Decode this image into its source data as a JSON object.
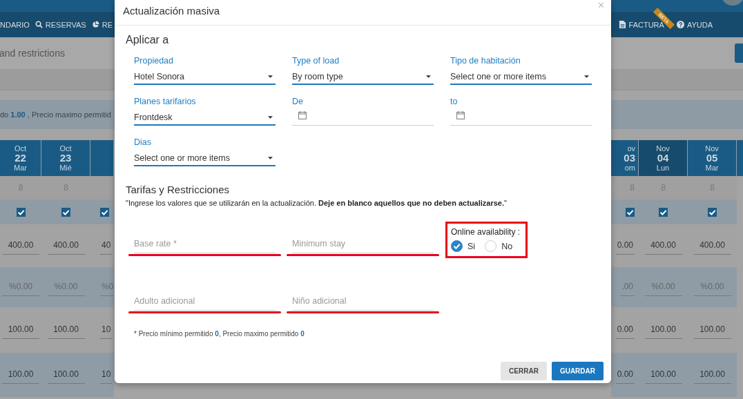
{
  "nav_left": [
    {
      "label": "NDARIO"
    },
    {
      "label": "RESERVAS"
    },
    {
      "label": "RE"
    }
  ],
  "nav_right": [
    {
      "label": "FACTURA",
      "badge": "BETA"
    },
    {
      "label": "AYUDA"
    }
  ],
  "page_title": "and restrictions",
  "notice": "do **1.00** , Precio maximo permitid",
  "calendar_left": [
    {
      "month": "Oct",
      "day": "22",
      "weekday": "Mar",
      "available": "8",
      "checked": true,
      "rate": "400.00",
      "percent": "%0.00",
      "adult": "100.00",
      "child": "100.00"
    },
    {
      "month": "Oct",
      "day": "23",
      "weekday": "Mié",
      "available": "8",
      "checked": true,
      "rate": "400.00",
      "percent": "%0.00",
      "adult": "100.00",
      "child": "100.00"
    },
    {
      "checked": true,
      "rate": "40",
      "percent": "%0",
      "adult": "10",
      "child": "10"
    }
  ],
  "calendar_right": [
    {
      "month": "ov",
      "day": "03",
      "weekday": "om",
      "available": "8",
      "checked": true,
      "rate": "0.00",
      "percent": ".00",
      "adult": "0.00",
      "child": "0.00"
    },
    {
      "month": "Nov",
      "day": "04",
      "weekday": "Lun",
      "available": "8",
      "checked": true,
      "rate": "400.00",
      "percent": "%0.00",
      "adult": "100.00",
      "child": "100.00"
    },
    {
      "month": "Nov",
      "day": "05",
      "weekday": "Mar",
      "available": "8",
      "checked": true,
      "rate": "400.00",
      "percent": "%0.00",
      "adult": "100.00",
      "child": "100.00"
    }
  ],
  "modal": {
    "title": "Actualización masiva",
    "close": "×",
    "apply_title": "Aplicar a",
    "fields": [
      {
        "kind": "select",
        "label": "Propiedad",
        "value": "Hotel Sonora"
      },
      {
        "kind": "select",
        "label": "Type of load",
        "value": "By room type"
      },
      {
        "kind": "select",
        "label": "Tipo de habitación",
        "placeholder": "Select one or more items"
      },
      {
        "kind": "select",
        "label": "Planes tarifarios",
        "value": "Frontdesk"
      },
      {
        "kind": "date",
        "label": "De"
      },
      {
        "kind": "date",
        "label": "to"
      },
      {
        "kind": "select",
        "label": "Dias",
        "placeholder": "Select one or more items"
      }
    ],
    "rates_title": "Tarifas y Restricciones",
    "rates_note": "\"Ingrese los valores que se utilizarán en la actualización. **Deje en blanco aquellos que no deben actualizarse.**\"",
    "rate_inputs": [
      {
        "placeholder": "Base rate *",
        "highlighted": true
      },
      {
        "placeholder": "Minimum stay",
        "highlighted": true
      },
      {
        "placeholder": "Adulto adicional",
        "highlighted": true
      },
      {
        "placeholder": "Niño adicional",
        "highlighted": true
      }
    ],
    "online_availability": {
      "label": "Online availability :",
      "highlighted": true,
      "options": [
        {
          "label": "Si",
          "selected": true
        },
        {
          "label": "No",
          "selected": false
        }
      ]
    },
    "footnote": "* Precio mínimo permitido **0**, Precio maximo permitido **0**",
    "buttons": [
      {
        "label": "CERRAR",
        "kind": "secondary"
      },
      {
        "label": "GUARDAR",
        "kind": "primary"
      }
    ]
  }
}
